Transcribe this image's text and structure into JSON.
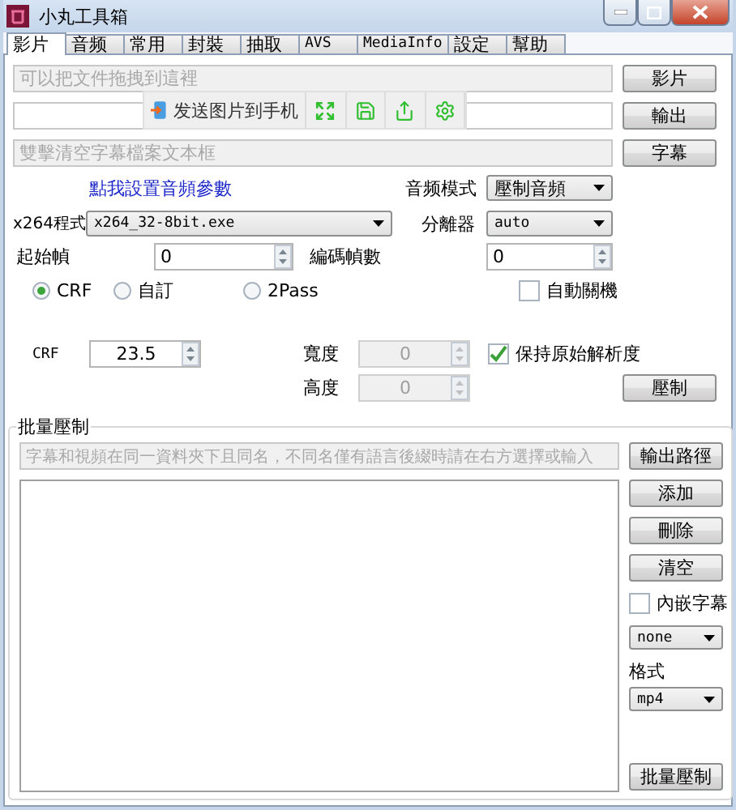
{
  "window": {
    "title": "小丸工具箱"
  },
  "tabs": [
    {
      "label": "影片",
      "selected": true
    },
    {
      "label": "音频",
      "selected": false
    },
    {
      "label": "常用",
      "selected": false
    },
    {
      "label": "封裝",
      "selected": false
    },
    {
      "label": "抽取",
      "selected": false
    },
    {
      "label": "AVS",
      "selected": false
    },
    {
      "label": "MediaInfo",
      "selected": false
    },
    {
      "label": "設定",
      "selected": false
    },
    {
      "label": "幫助",
      "selected": false
    }
  ],
  "files": [
    {
      "kind": "drop",
      "placeholder": "可以把文件拖拽到這裡",
      "button": "影片"
    },
    {
      "kind": "output",
      "button": "輸出"
    },
    {
      "kind": "drop",
      "placeholder": "雙擊清空字幕檔案文本框",
      "button": "字幕"
    }
  ],
  "share_toolbar": {
    "label": "发送图片到手机"
  },
  "audio_link": "點我設置音頻參數",
  "audio_mode": {
    "label": "音频模式",
    "value": "壓制音頻"
  },
  "x264": {
    "label": "x264程式",
    "value": "x264_32-8bit.exe"
  },
  "demuxer": {
    "label": "分離器",
    "value": "auto"
  },
  "start_frame": {
    "label": "起始幀",
    "value": "0"
  },
  "frame_count": {
    "label": "編碼幀數",
    "value": "0"
  },
  "rate_modes": [
    {
      "label": "CRF",
      "selected": true
    },
    {
      "label": "自訂",
      "selected": false
    },
    {
      "label": "2Pass",
      "selected": false
    }
  ],
  "shutdown": {
    "label": "自動關機",
    "checked": false
  },
  "crf": {
    "label": "CRF",
    "value": "23.5"
  },
  "width": {
    "label": "寬度",
    "value": "0",
    "disabled": true
  },
  "height": {
    "label": "高度",
    "value": "0",
    "disabled": true
  },
  "keep_resolution": {
    "label": "保持原始解析度",
    "checked": true
  },
  "encode_button": "壓制",
  "batch": {
    "title": "批量壓制",
    "placeholder": "字幕和視頻在同一資料夾下且同名，不同名僅有語言後綴時請在右方選擇或輸入",
    "output_button": "輸出路徑",
    "buttons": [
      "添加",
      "刪除",
      "清空"
    ],
    "embed_subtitles": {
      "label": "內嵌字幕",
      "checked": false
    },
    "subtitle_select": "none",
    "format_label": "格式",
    "format": "mp4",
    "start_button": "批量壓制"
  }
}
